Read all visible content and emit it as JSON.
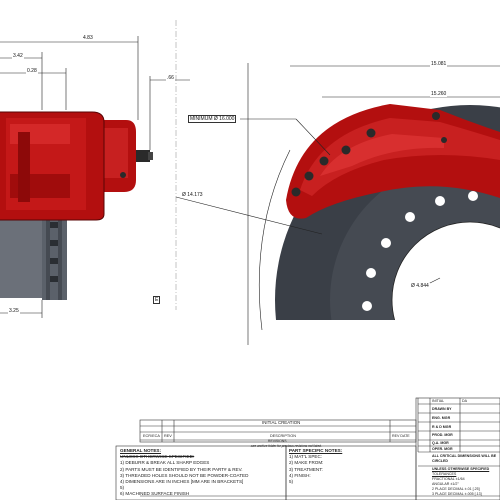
{
  "dimensions": {
    "overall_width": "4.83",
    "offset_a": "3.42",
    "offset_b": "0.28",
    "offset_c": ".66",
    "bottom_length": "3.25",
    "disc_outer": "15.081",
    "disc_inner": "15.260",
    "min_diameter": "MINIMUM Ø 16.000",
    "bolt_circle": "Ø 14.173",
    "hub_diameter": "Ø 4.844",
    "datum_e": "E"
  },
  "revision_block": {
    "initial_creation": "INITIAL CREATION",
    "col_ecr": "ECR/ECA",
    "col_rev": "REV",
    "col_description": "DESCRIPTION",
    "revisions_note": "REVISIONS",
    "archive_note": "-see archive folder for previous revisions not listed-",
    "col_date": "REV DATE"
  },
  "general_notes": {
    "title": "GENERAL NOTES:",
    "subtitle": "UNLESS OTHERWISE SPECIFIED:",
    "items": [
      "1) DEBURR & BREAK ALL SHARP EDGES",
      "2) PARTS MUST BE IDENTIFIED BY THEIR PART# & REV.",
      "3) THREADED HOLES SHOULD NOT BE POWDER-COATED",
      "4) DIMENSIONS ARE IN INCHES [MM ARE IN BRACKETS]",
      "5)",
      "6) MACHINED SURFACE FINISH"
    ]
  },
  "part_notes": {
    "title": "PART SPECIFIC NOTES:",
    "items": [
      "1) MAT'L SPEC:",
      "2) MAKE FROM:",
      "3) TREATMENT:",
      "4) FINISH:",
      "5)"
    ]
  },
  "title_block": {
    "initial_label": "INITIAL",
    "date_label": "DA",
    "roles": [
      "DRAWN BY",
      "ENG. MGR",
      "R & D MGR",
      "PROD. MGR",
      "Q.A. MGR",
      "OPER. MGR"
    ],
    "critical_title": "ALL CRITICAL DIMENSIONS WILL BE CIRCLED",
    "tolerance_title": "UNLESS OTHERWISE SPECIFIED",
    "tolerances_label": "TOLERANCES",
    "fractional": "FRACTIONAL ±1/64",
    "angular": "ANGULAR ±1/2°",
    "two_place": "2 PLACE DECIMAL ±.01 [.25]",
    "three_place": "3 PLACE DECIMAL ±.005 [.13]"
  },
  "colors": {
    "caliper": "#b30f0f",
    "caliper_dark": "#7a0606",
    "caliper_highlight": "#e23a3a",
    "disc": "#3a3f47",
    "disc_light": "#5b616a",
    "bolt": "#2a2a2a"
  }
}
